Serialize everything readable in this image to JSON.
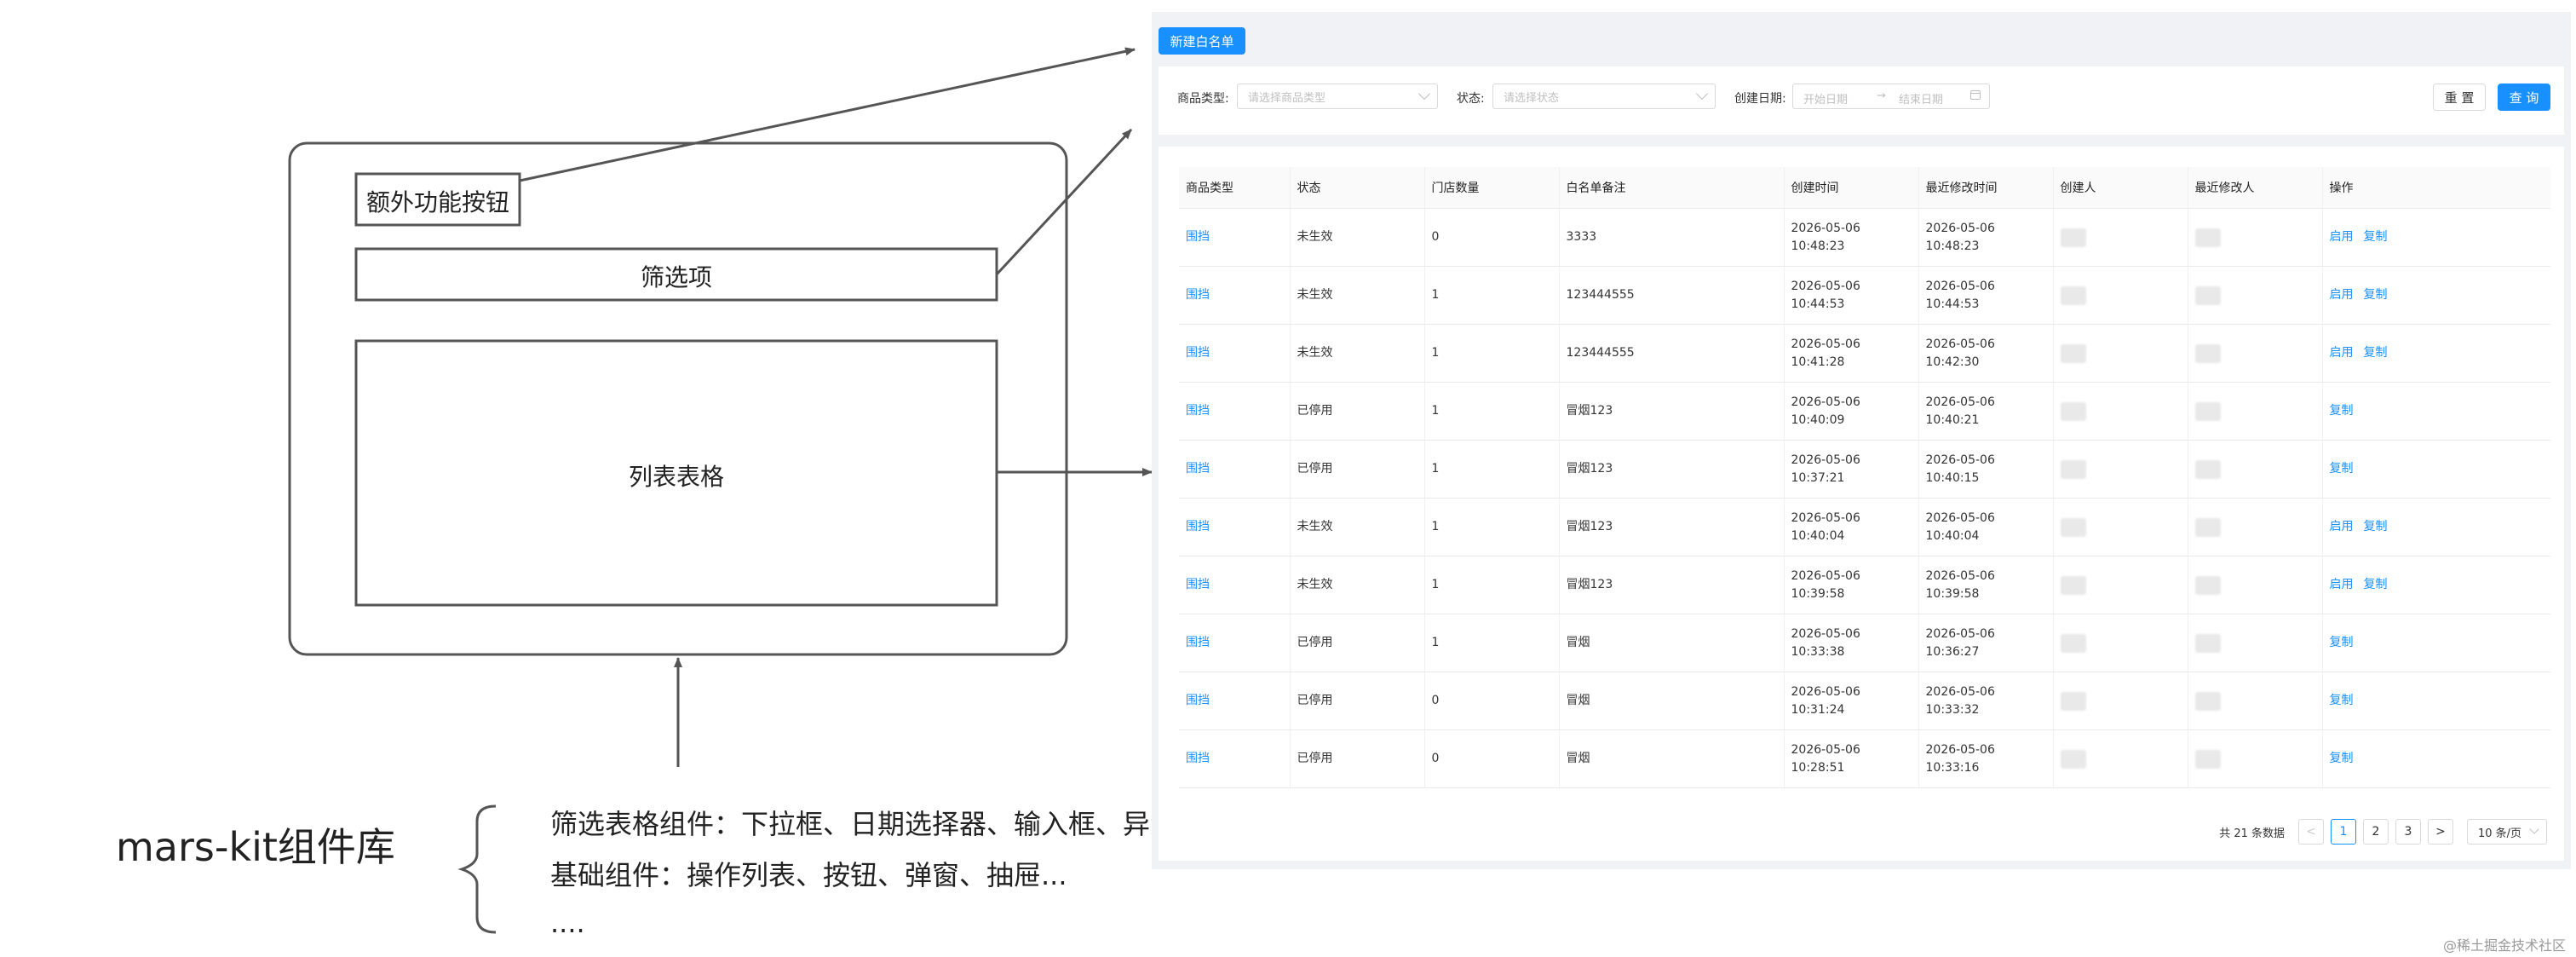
{
  "diagram": {
    "extra_button_label": "额外功能按钮",
    "filter_label": "筛选项",
    "table_label": "列表表格",
    "library_title": "mars-kit组件库",
    "library_items": [
      "筛选表格组件：下拉框、日期选择器、输入框、异步选择器...",
      "基础组件：操作列表、按钮、弹窗、抽屉...",
      "...."
    ]
  },
  "ui": {
    "new_button": "新建白名单",
    "filters": {
      "goods_type_label": "商品类型:",
      "goods_type_placeholder": "请选择商品类型",
      "status_label": "状态:",
      "status_placeholder": "请选择状态",
      "date_label": "创建日期:",
      "start_placeholder": "开始日期",
      "arrow": "→",
      "end_placeholder": "结束日期",
      "reset_button": "重 置",
      "query_button": "查 询"
    },
    "table": {
      "columns": [
        "商品类型",
        "状态",
        "门店数量",
        "白名单备注",
        "创建时间",
        "最近修改时间",
        "创建人",
        "最近修改人",
        "操作"
      ],
      "rows": [
        {
          "type": "围挡",
          "status": "未生效",
          "count": "0",
          "note": "3333",
          "created_date": "2026-05-06",
          "created_time": "10:48:23",
          "modified_date": "2026-05-06",
          "modified_time": "10:48:23",
          "actions": [
            "启用",
            "复制"
          ]
        },
        {
          "type": "围挡",
          "status": "未生效",
          "count": "1",
          "note": "123444555",
          "created_date": "2026-05-06",
          "created_time": "10:44:53",
          "modified_date": "2026-05-06",
          "modified_time": "10:44:53",
          "actions": [
            "启用",
            "复制"
          ]
        },
        {
          "type": "围挡",
          "status": "未生效",
          "count": "1",
          "note": "123444555",
          "created_date": "2026-05-06",
          "created_time": "10:41:28",
          "modified_date": "2026-05-06",
          "modified_time": "10:42:30",
          "actions": [
            "启用",
            "复制"
          ]
        },
        {
          "type": "围挡",
          "status": "已停用",
          "count": "1",
          "note": "冒烟123",
          "created_date": "2026-05-06",
          "created_time": "10:40:09",
          "modified_date": "2026-05-06",
          "modified_time": "10:40:21",
          "actions": [
            "复制"
          ]
        },
        {
          "type": "围挡",
          "status": "已停用",
          "count": "1",
          "note": "冒烟123",
          "created_date": "2026-05-06",
          "created_time": "10:37:21",
          "modified_date": "2026-05-06",
          "modified_time": "10:40:15",
          "actions": [
            "复制"
          ]
        },
        {
          "type": "围挡",
          "status": "未生效",
          "count": "1",
          "note": "冒烟123",
          "created_date": "2026-05-06",
          "created_time": "10:40:04",
          "modified_date": "2026-05-06",
          "modified_time": "10:40:04",
          "actions": [
            "启用",
            "复制"
          ]
        },
        {
          "type": "围挡",
          "status": "未生效",
          "count": "1",
          "note": "冒烟123",
          "created_date": "2026-05-06",
          "created_time": "10:39:58",
          "modified_date": "2026-05-06",
          "modified_time": "10:39:58",
          "actions": [
            "启用",
            "复制"
          ]
        },
        {
          "type": "围挡",
          "status": "已停用",
          "count": "1",
          "note": "冒烟",
          "created_date": "2026-05-06",
          "created_time": "10:33:38",
          "modified_date": "2026-05-06",
          "modified_time": "10:36:27",
          "actions": [
            "复制"
          ]
        },
        {
          "type": "围挡",
          "status": "已停用",
          "count": "0",
          "note": "冒烟",
          "created_date": "2026-05-06",
          "created_time": "10:31:24",
          "modified_date": "2026-05-06",
          "modified_time": "10:33:32",
          "actions": [
            "复制"
          ]
        },
        {
          "type": "围挡",
          "status": "已停用",
          "count": "0",
          "note": "冒烟",
          "created_date": "2026-05-06",
          "created_time": "10:28:51",
          "modified_date": "2026-05-06",
          "modified_time": "10:33:16",
          "actions": [
            "复制"
          ]
        }
      ]
    },
    "pagination": {
      "total_text": "共 21 条数据",
      "prev": "<",
      "pages": [
        "1",
        "2",
        "3"
      ],
      "current": "1",
      "next": ">",
      "page_size": "10 条/页"
    }
  },
  "watermark": "@稀土掘金技术社区",
  "colors": {
    "primary": "#1890ff",
    "panel_bg": "#f0f2f5",
    "line": "#555555"
  }
}
